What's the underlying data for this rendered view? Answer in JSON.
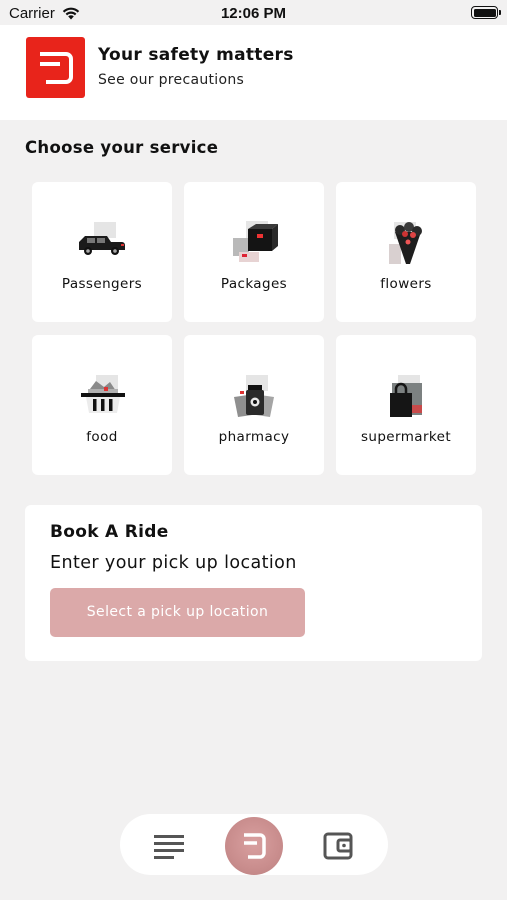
{
  "status_bar": {
    "carrier": "Carrier",
    "time": "12:06 PM"
  },
  "banner": {
    "title": "Your safety matters",
    "subtitle": "See our precautions"
  },
  "services": {
    "heading": "Choose your service",
    "items": [
      {
        "label": "Passengers",
        "icon": "car-icon"
      },
      {
        "label": "Packages",
        "icon": "package-icon"
      },
      {
        "label": "flowers",
        "icon": "flowers-icon"
      },
      {
        "label": "food",
        "icon": "food-basket-icon"
      },
      {
        "label": "pharmacy",
        "icon": "pharmacy-icon"
      },
      {
        "label": "supermarket",
        "icon": "supermarket-bag-icon"
      }
    ]
  },
  "ride": {
    "title": "Book A Ride",
    "subtitle": "Enter your pick up location",
    "button_label": "Select a pick up location"
  },
  "bottom_nav": {
    "items": [
      "list-icon",
      "home-logo-icon",
      "wallet-icon"
    ]
  },
  "colors": {
    "brand_red": "#e8241b",
    "button_disabled": "#dba9a9",
    "background": "#f2f1f1"
  }
}
